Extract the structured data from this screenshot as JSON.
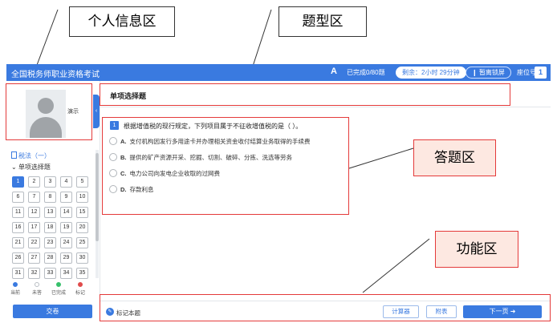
{
  "annotations": {
    "personal_info": "个人信息区",
    "question_type": "题型区",
    "answer": "答题区",
    "function": "功能区"
  },
  "header": {
    "app_title": "全国税务师职业资格考试",
    "font_icon": "A",
    "done_text": "已完成0/80题",
    "time_remaining": "剩余：2小时 29分钟",
    "pause_button": "暂离锁屏",
    "seat_label": "座位号",
    "seat_number": "1"
  },
  "sidebar": {
    "user_name": "演示",
    "subject": "税法（一）",
    "section": "单项选择题",
    "questions": [
      "1",
      "2",
      "3",
      "4",
      "5",
      "6",
      "7",
      "8",
      "9",
      "10",
      "11",
      "12",
      "13",
      "14",
      "15",
      "16",
      "17",
      "18",
      "19",
      "20",
      "21",
      "22",
      "23",
      "24",
      "25",
      "26",
      "27",
      "28",
      "29",
      "30",
      "31",
      "32",
      "33",
      "34",
      "35"
    ],
    "current_question": "1",
    "legend": [
      {
        "label": "当前",
        "color": "#3a7ae0"
      },
      {
        "label": "未答",
        "color": "#ffffff"
      },
      {
        "label": "已完成",
        "color": "#37c06b"
      },
      {
        "label": "标记",
        "color": "#e04b4b"
      }
    ],
    "submit_label": "交卷",
    "collapse_icon": "chevron-left-icon"
  },
  "main": {
    "question_type": "单项选择题",
    "question_number": "1",
    "question_text": "根据增值税的现行规定，下列项目属于不征收增值税的是（    ）。",
    "options": [
      {
        "letter": "A.",
        "text": "支付机构因发行多用途卡并办理相关资金收付结算业务取得的手续费"
      },
      {
        "letter": "B.",
        "text": "提供的矿产资源开采、挖掘、切割、破碎、分拣、洗选等劳务"
      },
      {
        "letter": "C.",
        "text": "电力公司向发电企业收取的过网费"
      },
      {
        "letter": "D.",
        "text": "存款利息"
      }
    ]
  },
  "footer": {
    "mark_label": "标记本题",
    "calculator_label": "计算器",
    "attachment_label": "附表",
    "next_label": "下一页"
  }
}
